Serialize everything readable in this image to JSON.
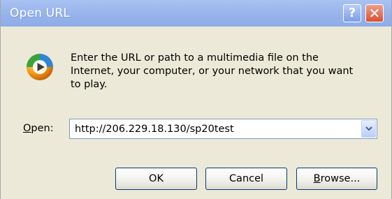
{
  "window": {
    "title": "Open URL",
    "help_glyph": "?",
    "close_glyph": "✕"
  },
  "message": "Enter the URL or path to a multimedia file on the Internet, your computer, or your network that you want to play.",
  "open_field": {
    "label_accel": "O",
    "label_rest": "pen:",
    "value": "http://206.229.18.130/sp20test"
  },
  "buttons": {
    "ok": "OK",
    "cancel": "Cancel",
    "browse_accel": "B",
    "browse_rest": "rowse..."
  },
  "icons": {
    "dialog_icon": "media-player-icon",
    "dropdown": "chevron-down-icon"
  },
  "colors": {
    "titlebar": "#9db8ee",
    "dialog_bg": "#ece9d8",
    "close_button": "#d8502f",
    "button_border": "#003c74"
  }
}
